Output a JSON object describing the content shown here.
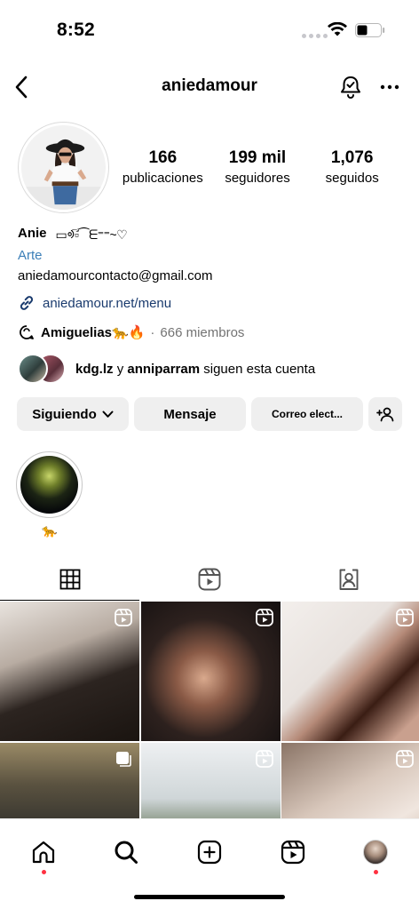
{
  "status_bar": {
    "time": "8:52"
  },
  "header": {
    "title": "aniedamour",
    "back_icon": "chevron-left-icon",
    "notify_icon": "bell-check-icon",
    "more_icon": "more-horizontal-icon"
  },
  "profile": {
    "stats": [
      {
        "count": "166",
        "label": "publicaciones"
      },
      {
        "count": "199 mil",
        "label": "seguidores"
      },
      {
        "count": "1,076",
        "label": "seguidos"
      }
    ],
    "name": "Anie",
    "name_symbols": "▭ᢀ▫︎⃕⁀ᗴ⁼⁼~♡",
    "category": "Arte",
    "email": "aniedamourcontacto@gmail.com",
    "link": "aniedamour.net/menu"
  },
  "channel": {
    "name": "Amiguelias🐆🔥",
    "separator": "·",
    "members": "666 miembros"
  },
  "mutual": {
    "user1": "kdg.lz",
    "connector": "y",
    "user2": "anniparram",
    "suffix": "siguen esta cuenta"
  },
  "actions": {
    "following": "Siguiendo",
    "message": "Mensaje",
    "email": "Correo elect..."
  },
  "highlights": [
    {
      "label": "🐆"
    }
  ],
  "tabs": [
    "grid-icon",
    "reels-icon",
    "tagged-icon"
  ],
  "colors": {
    "link_blue": "#3c7fb8",
    "button_bg": "#efefef",
    "notification_dot": "#ff3040"
  }
}
